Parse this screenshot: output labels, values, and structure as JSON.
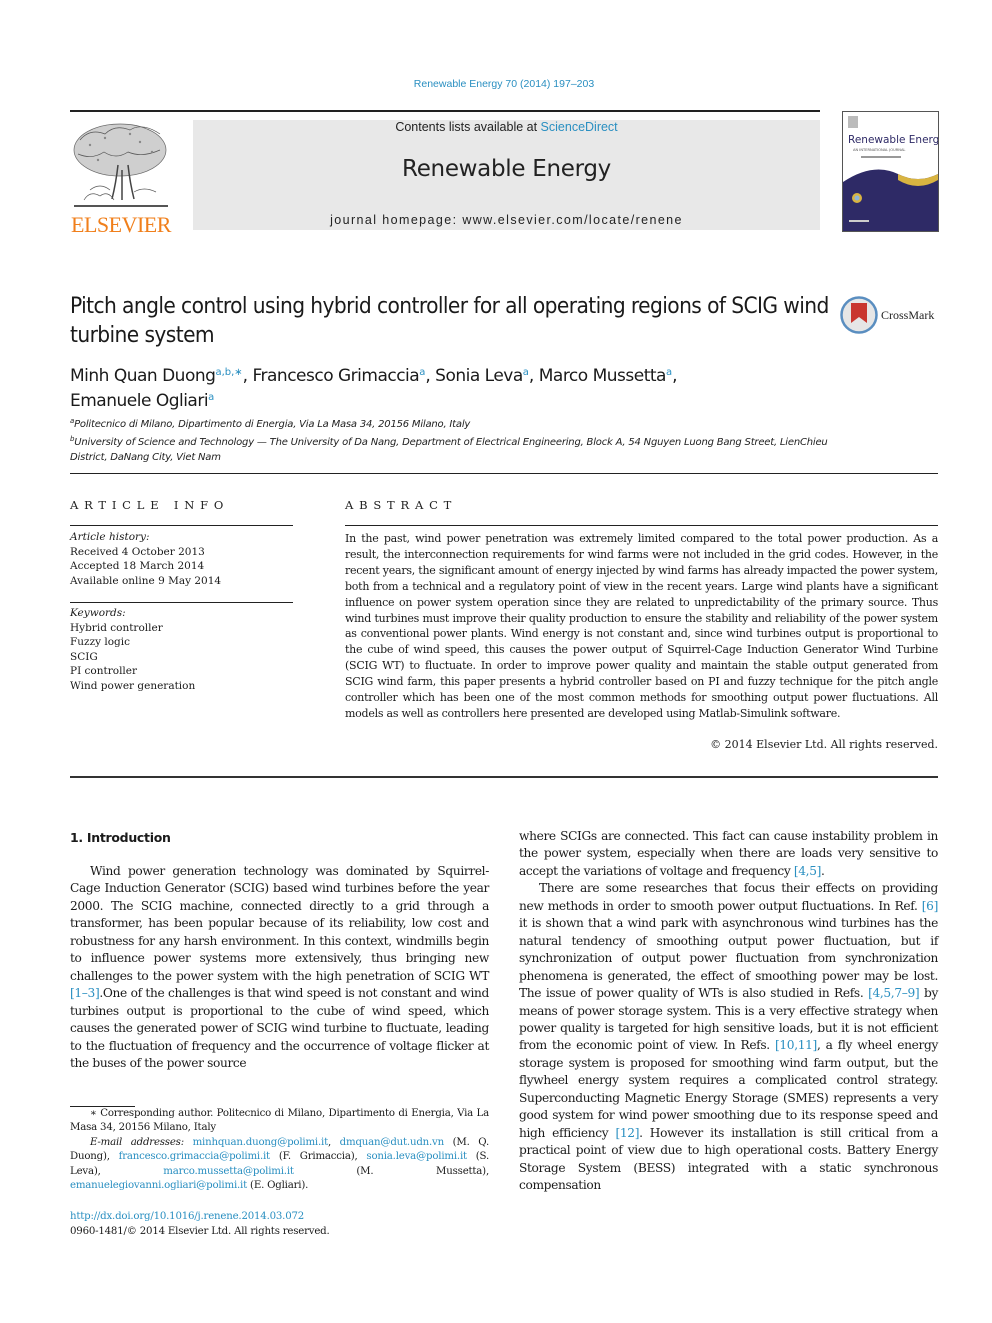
{
  "header": {
    "citation": "Renewable Energy 70 (2014) 197–203",
    "publisher_wordmark": "ELSEVIER",
    "contents_prefix": "Contents lists available at ",
    "contents_link": "ScienceDirect",
    "journal_name": "Renewable Energy",
    "homepage": "journal homepage: www.elsevier.com/locate/renene",
    "cover": {
      "title": "Renewable Energy",
      "subtitle": "AN INTERNATIONAL JOURNAL"
    },
    "crossmark_label": "CrossMark",
    "colors": {
      "link": "#2a8fc1",
      "elsevier_orange": "#f07f1b",
      "banner_bg": "#e8e8e8",
      "cover_navy": "#2e2a66",
      "cover_gold": "#d9b441"
    }
  },
  "article": {
    "title": "Pitch angle control using hybrid controller for all operating regions of SCIG wind turbine system",
    "authors": [
      {
        "name": "Minh Quan Duong",
        "sup": "a,b,∗",
        "sep": ", "
      },
      {
        "name": "Francesco Grimaccia",
        "sup": "a",
        "sep": ", "
      },
      {
        "name": "Sonia Leva",
        "sup": "a",
        "sep": ", "
      },
      {
        "name": "Marco Mussetta",
        "sup": "a",
        "sep": ","
      },
      {
        "name": "Emanuele Ogliari",
        "sup": "a",
        "sep": ""
      }
    ],
    "affiliations": [
      {
        "mark": "a",
        "text": "Politecnico di Milano, Dipartimento di Energia, Via La Masa 34, 20156 Milano, Italy"
      },
      {
        "mark": "b",
        "text": "University of Science and Technology — The University of Da Nang, Department of Electrical Engineering, Block A, 54 Nguyen Luong Bang Street, LienChieu District, DaNang City, Viet Nam"
      }
    ]
  },
  "article_info": {
    "heading": "ARTICLE INFO",
    "history_label": "Article history:",
    "history": [
      "Received 4 October 2013",
      "Accepted 18 March 2014",
      "Available online 9 May 2014"
    ],
    "keywords_label": "Keywords:",
    "keywords": [
      "Hybrid controller",
      "Fuzzy logic",
      "SCIG",
      "PI controller",
      "Wind power generation"
    ]
  },
  "abstract": {
    "heading": "ABSTRACT",
    "text": "In the past, wind power penetration was extremely limited compared to the total power production. As a result, the interconnection requirements for wind farms were not included in the grid codes. However, in the recent years, the significant amount of energy injected by wind farms has already impacted the power system, both from a technical and a regulatory point of view in the recent years. Large wind plants have a significant influence on power system operation since they are related to unpredictability of the primary source. Thus wind turbines must improve their quality production to ensure the stability and reliability of the power system as conventional power plants. Wind energy is not constant and, since wind turbines output is proportional to the cube of wind speed, this causes the power output of Squirrel-Cage Induction Generator Wind Turbine (SCIG WT) to fluctuate. In order to improve power quality and maintain the stable output generated from SCIG wind farm, this paper presents a hybrid controller based on PI and fuzzy technique for the pitch angle controller which has been one of the most common methods for smoothing output power fluctuations. All models as well as controllers here presented are developed using Matlab-Simulink software.",
    "copyright": "© 2014 Elsevier Ltd. All rights reserved."
  },
  "body": {
    "section_heading": "1.  Introduction",
    "left_p1": [
      {
        "t": "Wind power generation technology was dominated by Squirrel-Cage Induction Generator (SCIG) based wind turbines before the year 2000. The SCIG machine, connected directly to a grid through a transformer, has been popular because of its reliability, low cost and robustness for any harsh environment. In this context, windmills begin to influence power systems more extensively, thus bringing new challenges to the power system with the high penetration of SCIG WT "
      },
      {
        "ref": "[1–3]"
      },
      {
        "t": ".One of the challenges is that wind speed is not constant and wind turbines output is proportional to the cube of wind speed, which causes the generated power of SCIG wind turbine to fluctuate, leading to the fluctuation of frequency and the occurrence of voltage flicker at the buses of the power source"
      }
    ],
    "right_p1": [
      {
        "t": "where SCIGs are connected. This fact can cause instability problem in the power system, especially when there are loads very sensitive to accept the variations of voltage and frequency "
      },
      {
        "ref": "[4,5]"
      },
      {
        "t": "."
      }
    ],
    "right_p2": [
      {
        "t": "There are some researches that focus their effects on providing new methods in order to smooth power output fluctuations. In Ref. "
      },
      {
        "ref": "[6]"
      },
      {
        "t": " it is shown that a wind park with asynchronous wind turbines has the natural tendency of smoothing output power fluctuation, but if synchronization of output power fluctuation from synchronization phenomena is generated, the effect of smoothing power may be lost. The issue of power quality of WTs is also studied in Refs. "
      },
      {
        "ref": "[4,5,7–9]"
      },
      {
        "t": " by means of power storage system. This is a very effective strategy when power quality is targeted for high sensitive loads, but it is not efficient from the economic point of view. In Refs. "
      },
      {
        "ref": "[10,11]"
      },
      {
        "t": ", a fly wheel energy storage system is proposed for smoothing wind farm output, but the flywheel energy system requires a complicated control strategy. Superconducting Magnetic Energy Storage (SMES) represents a very good system for wind power smoothing due to its response speed and high efficiency "
      },
      {
        "ref": "[12]"
      },
      {
        "t": ". However its installation is still critical from a practical point of view due to high operational costs. Battery Energy Storage System (BESS) integrated with a static synchronous compensation"
      }
    ]
  },
  "footnote": {
    "corresponding": "∗ Corresponding author. Politecnico di Milano, Dipartimento di Energia, Via La Masa 34, 20156 Milano, Italy",
    "email_label": "E-mail addresses:",
    "emails": [
      {
        "email": "minhquan.duong@polimi.it",
        "after": ", "
      },
      {
        "email": "dmquan@dut.udn.vn",
        "after": " (M. Q. Duong), "
      },
      {
        "email": "francesco.grimaccia@polimi.it",
        "after": " (F. Grimaccia), "
      },
      {
        "email": "sonia.leva@polimi.it",
        "after": " (S. Leva), "
      },
      {
        "email": "marco.mussetta@polimi.it",
        "after": " (M. Mussetta), "
      },
      {
        "email": "emanuelegiovanni.ogliari@polimi.it",
        "after": " (E. Ogliari)."
      }
    ],
    "doi": "http://dx.doi.org/10.1016/j.renene.2014.03.072",
    "issn": "0960-1481/© 2014 Elsevier Ltd. All rights reserved."
  }
}
